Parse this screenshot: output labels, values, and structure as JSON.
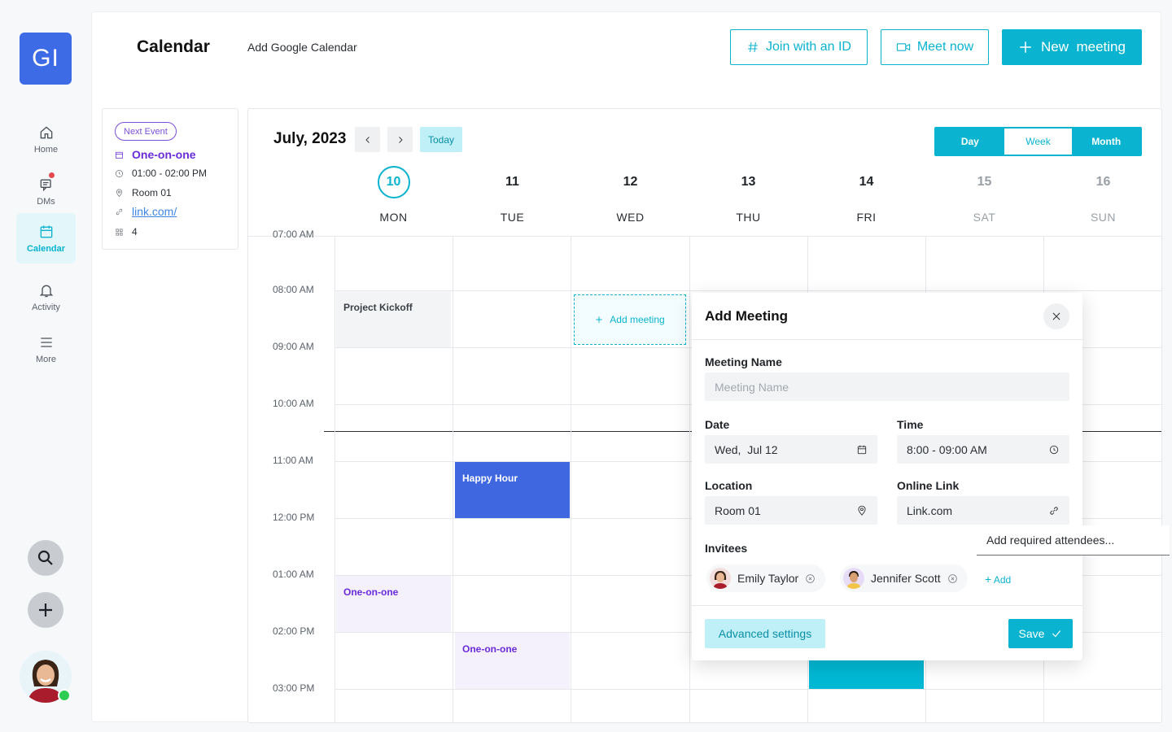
{
  "app": {
    "logo_text": "GI",
    "page_title": "Calendar",
    "add_google_calendar": "Add Google Calendar"
  },
  "nav": {
    "items": [
      {
        "label": "Home",
        "icon": "home-icon"
      },
      {
        "label": "DMs",
        "icon": "chat-icon"
      },
      {
        "label": "Calendar",
        "icon": "calendar-icon"
      },
      {
        "label": "Activity",
        "icon": "bell-icon"
      },
      {
        "label": "More",
        "icon": "menu-icon"
      }
    ],
    "active": "Calendar"
  },
  "header": {
    "join_label": "Join with an ID",
    "meet_now_label": "Meet now",
    "new_meeting_label": "New  meeting"
  },
  "next_event": {
    "badge": "Next Event",
    "title": "One-on-one",
    "time": "01:00 - 02:00 PM",
    "location": "Room 01",
    "link": "link.com/",
    "attendees": "4"
  },
  "calendar": {
    "month_label": "July, 2023",
    "today_label": "Today",
    "views": [
      "Day",
      "Week",
      "Month"
    ],
    "selected_view": "Week",
    "days": [
      {
        "num": "10",
        "name": "MON",
        "current": true
      },
      {
        "num": "11",
        "name": "TUE"
      },
      {
        "num": "12",
        "name": "WED"
      },
      {
        "num": "13",
        "name": "THU"
      },
      {
        "num": "14",
        "name": "FRI"
      },
      {
        "num": "15",
        "name": "SAT",
        "weekend": true
      },
      {
        "num": "16",
        "name": "SUN",
        "weekend": true
      }
    ],
    "time_labels": [
      "07:00 AM",
      "08:00 AM",
      "09:00 AM",
      "10:00 AM",
      "11:00 AM",
      "12:00 PM",
      "01:00 AM",
      "02:00 PM",
      "03:00 PM"
    ],
    "events": [
      {
        "title": "Project Kickoff",
        "day": "MON",
        "start": "08:00 AM",
        "end": "09:00 AM",
        "color": "#f3f4f6",
        "text_color": "#3b4046"
      },
      {
        "title": "Happy Hour",
        "day": "TUE",
        "start": "11:00 AM",
        "end": "12:00 PM",
        "color": "#3f67e0",
        "text_color": "#ffffff"
      },
      {
        "title": "One-on-one",
        "day": "MON",
        "start": "01:00 PM",
        "end": "02:00 PM",
        "color": "#f4f0fc",
        "text_color": "#6a2bd9"
      },
      {
        "title": "One-on-one",
        "day": "TUE",
        "start": "02:00 PM",
        "end": "03:00 PM",
        "color": "#f4f0fc",
        "text_color": "#6a2bd9"
      },
      {
        "title": "",
        "day": "FRI",
        "start": "02:00 PM",
        "end": "03:00 PM",
        "color": "#00b8d4",
        "text_color": "#ffffff"
      }
    ],
    "add_meeting_slot": "Add meeting"
  },
  "modal": {
    "title": "Add Meeting",
    "meeting_name_label": "Meeting Name",
    "meeting_name_placeholder": "Meeting Name",
    "date_label": "Date",
    "date_value": "Wed,  Jul 12",
    "time_label": "Time",
    "time_value": "8:00 - 09:00 AM",
    "location_label": "Location",
    "location_value": "Room 01",
    "online_link_label": "Online Link",
    "online_link_value": "Link.com",
    "invitees_label": "Invitees",
    "invitees": [
      "Emily Taylor",
      "Jennifer Scott"
    ],
    "add_invitee_label": "Add",
    "attendee_placeholder": "Add required attendees...",
    "advanced_label": "Advanced settings",
    "save_label": "Save"
  },
  "colors": {
    "accent": "#0ab3cf",
    "brand_blue": "#3d6be6",
    "purple": "#6a2bd9",
    "online": "#2ecc52"
  }
}
